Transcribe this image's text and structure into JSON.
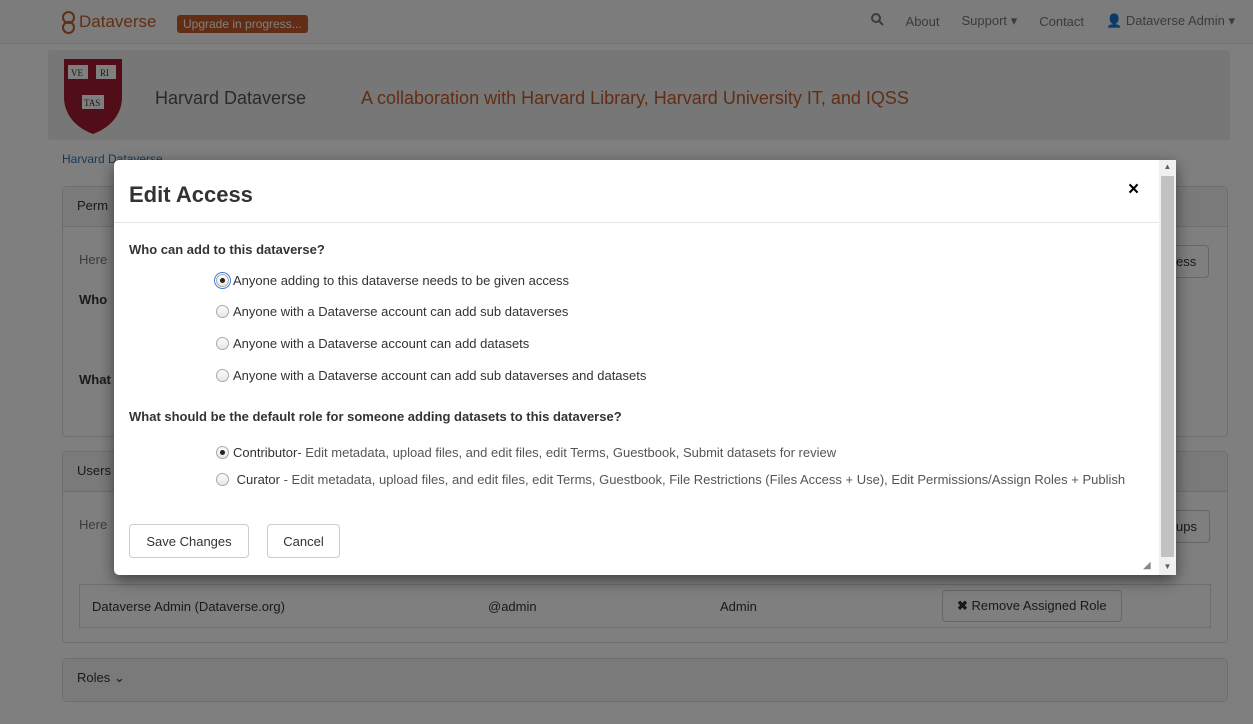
{
  "navbar": {
    "brand": "Dataverse",
    "upgrade_badge": "Upgrade in progress...",
    "about": "About",
    "support": "Support",
    "contact": "Contact",
    "user": "Dataverse Admin"
  },
  "banner": {
    "shield_text": [
      "VE",
      "RI",
      "TAS"
    ],
    "name": "Harvard Dataverse",
    "tagline": "A collaboration with Harvard Library, Harvard University IT, and IQSS"
  },
  "breadcrumb": "Harvard Dataverse",
  "background": {
    "permissions_head": "Perm",
    "here1": "Here",
    "who": "Who",
    "what": "What",
    "edit_access_btn": "ess",
    "users_head": "Users",
    "here2": "Here",
    "groups_btn": "ups",
    "row": {
      "name": "Dataverse Admin (Dataverse.org)",
      "alias": "@admin",
      "role": "Admin",
      "remove": "Remove Assigned Role"
    },
    "roles_head": "Roles"
  },
  "modal": {
    "title": "Edit Access",
    "close": "×",
    "q1": "Who can add to this dataverse?",
    "options": [
      {
        "label": "Anyone adding to this dataverse needs to be given access",
        "checked": true
      },
      {
        "label": "Anyone with a Dataverse account can add sub dataverses",
        "checked": false
      },
      {
        "label": "Anyone with a Dataverse account can add datasets",
        "checked": false
      },
      {
        "label": "Anyone with a Dataverse account can add sub dataverses and datasets",
        "checked": false
      }
    ],
    "q2": "What should be the default role for someone adding datasets to this dataverse?",
    "roles": [
      {
        "name": "Contributor",
        "desc": " - Edit metadata, upload files, and edit files, edit Terms, Guestbook, Submit datasets for review",
        "checked": true
      },
      {
        "name": "Curator",
        "desc": " - Edit metadata, upload files, and edit files, edit Terms, Guestbook, File Restrictions (Files Access + Use), Edit Permissions/Assign Roles + Publish",
        "checked": false
      }
    ],
    "save": "Save Changes",
    "cancel": "Cancel"
  },
  "colors": {
    "brand": "#c55b28",
    "link": "#3174af"
  }
}
